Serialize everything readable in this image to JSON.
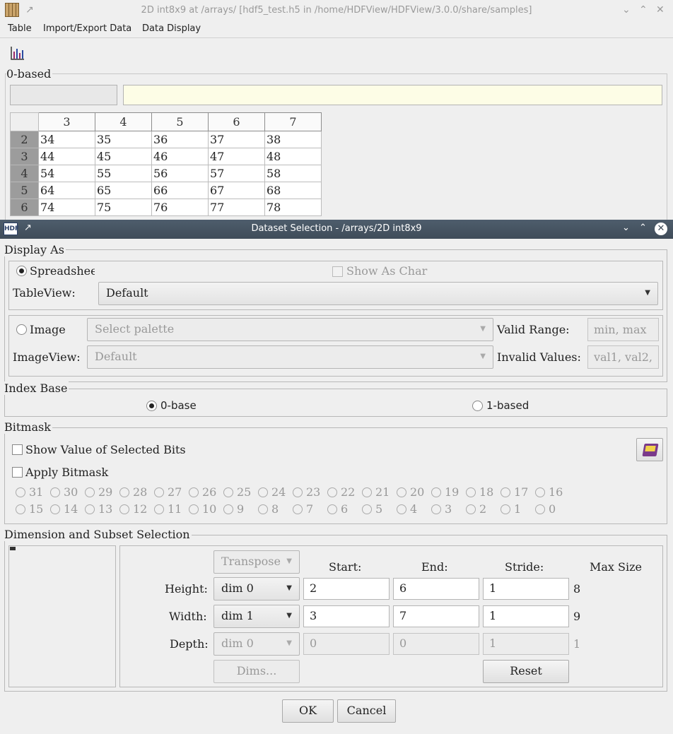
{
  "main_window": {
    "title": "2D int8x9 at /arrays/ [hdf5_test.h5 in /home/HDFView/HDFView/3.0.0/share/samples]",
    "menu": [
      "Table",
      "Import/Export Data",
      "Data Display"
    ],
    "index_group_label": "0-based",
    "table": {
      "col_headers": [
        "3",
        "4",
        "5",
        "6",
        "7"
      ],
      "rows": [
        {
          "header": "2",
          "cells": [
            "34",
            "35",
            "36",
            "37",
            "38"
          ]
        },
        {
          "header": "3",
          "cells": [
            "44",
            "45",
            "46",
            "47",
            "48"
          ]
        },
        {
          "header": "4",
          "cells": [
            "54",
            "55",
            "56",
            "57",
            "58"
          ]
        },
        {
          "header": "5",
          "cells": [
            "64",
            "65",
            "66",
            "67",
            "68"
          ]
        },
        {
          "header": "6",
          "cells": [
            "74",
            "75",
            "76",
            "77",
            "78"
          ]
        }
      ]
    }
  },
  "dialog": {
    "title": "Dataset Selection - /arrays/2D int8x9",
    "display_as": {
      "label": "Display As",
      "spreadsheet_label": "Spreadshee",
      "spreadsheet_selected": true,
      "show_as_char_label": "Show As Char",
      "tableview_label": "TableView:",
      "tableview_value": "Default",
      "image_label": "Image",
      "palette_placeholder": "Select palette",
      "valid_range_label": "Valid Range:",
      "valid_range_placeholder": "min, max",
      "imageview_label": "ImageView:",
      "imageview_value": "Default",
      "invalid_values_label": "Invalid Values:",
      "invalid_values_placeholder": "val1, val2,"
    },
    "index_base": {
      "label": "Index Base",
      "zero_label": "0-base",
      "one_label": "1-based",
      "selected": "0-based"
    },
    "bitmask": {
      "label": "Bitmask",
      "show_value_label": "Show Value of Selected Bits",
      "apply_label": "Apply Bitmask",
      "bits_row1": [
        "31",
        "30",
        "29",
        "28",
        "27",
        "26",
        "25",
        "24",
        "23",
        "22",
        "21",
        "20",
        "19",
        "18",
        "17",
        "16"
      ],
      "bits_row2": [
        "15",
        "14",
        "13",
        "12",
        "11",
        "10",
        "9",
        "8",
        "7",
        "6",
        "5",
        "4",
        "3",
        "2",
        "1",
        "0"
      ]
    },
    "dimension": {
      "label": "Dimension and Subset Selection",
      "transpose_label": "Transpose",
      "start_header": "Start:",
      "end_header": "End:",
      "stride_header": "Stride:",
      "max_size_header": "Max Size",
      "height": {
        "label": "Height:",
        "dim": "dim 0",
        "start": "2",
        "end": "6",
        "stride": "1",
        "max": "8"
      },
      "width": {
        "label": "Width:",
        "dim": "dim 1",
        "start": "3",
        "end": "7",
        "stride": "1",
        "max": "9"
      },
      "depth": {
        "label": "Depth:",
        "dim": "dim 0",
        "start": "0",
        "end": "0",
        "stride": "1",
        "max": "1"
      },
      "dims_button": "Dims...",
      "reset_button": "Reset"
    },
    "ok_button": "OK",
    "cancel_button": "Cancel"
  }
}
